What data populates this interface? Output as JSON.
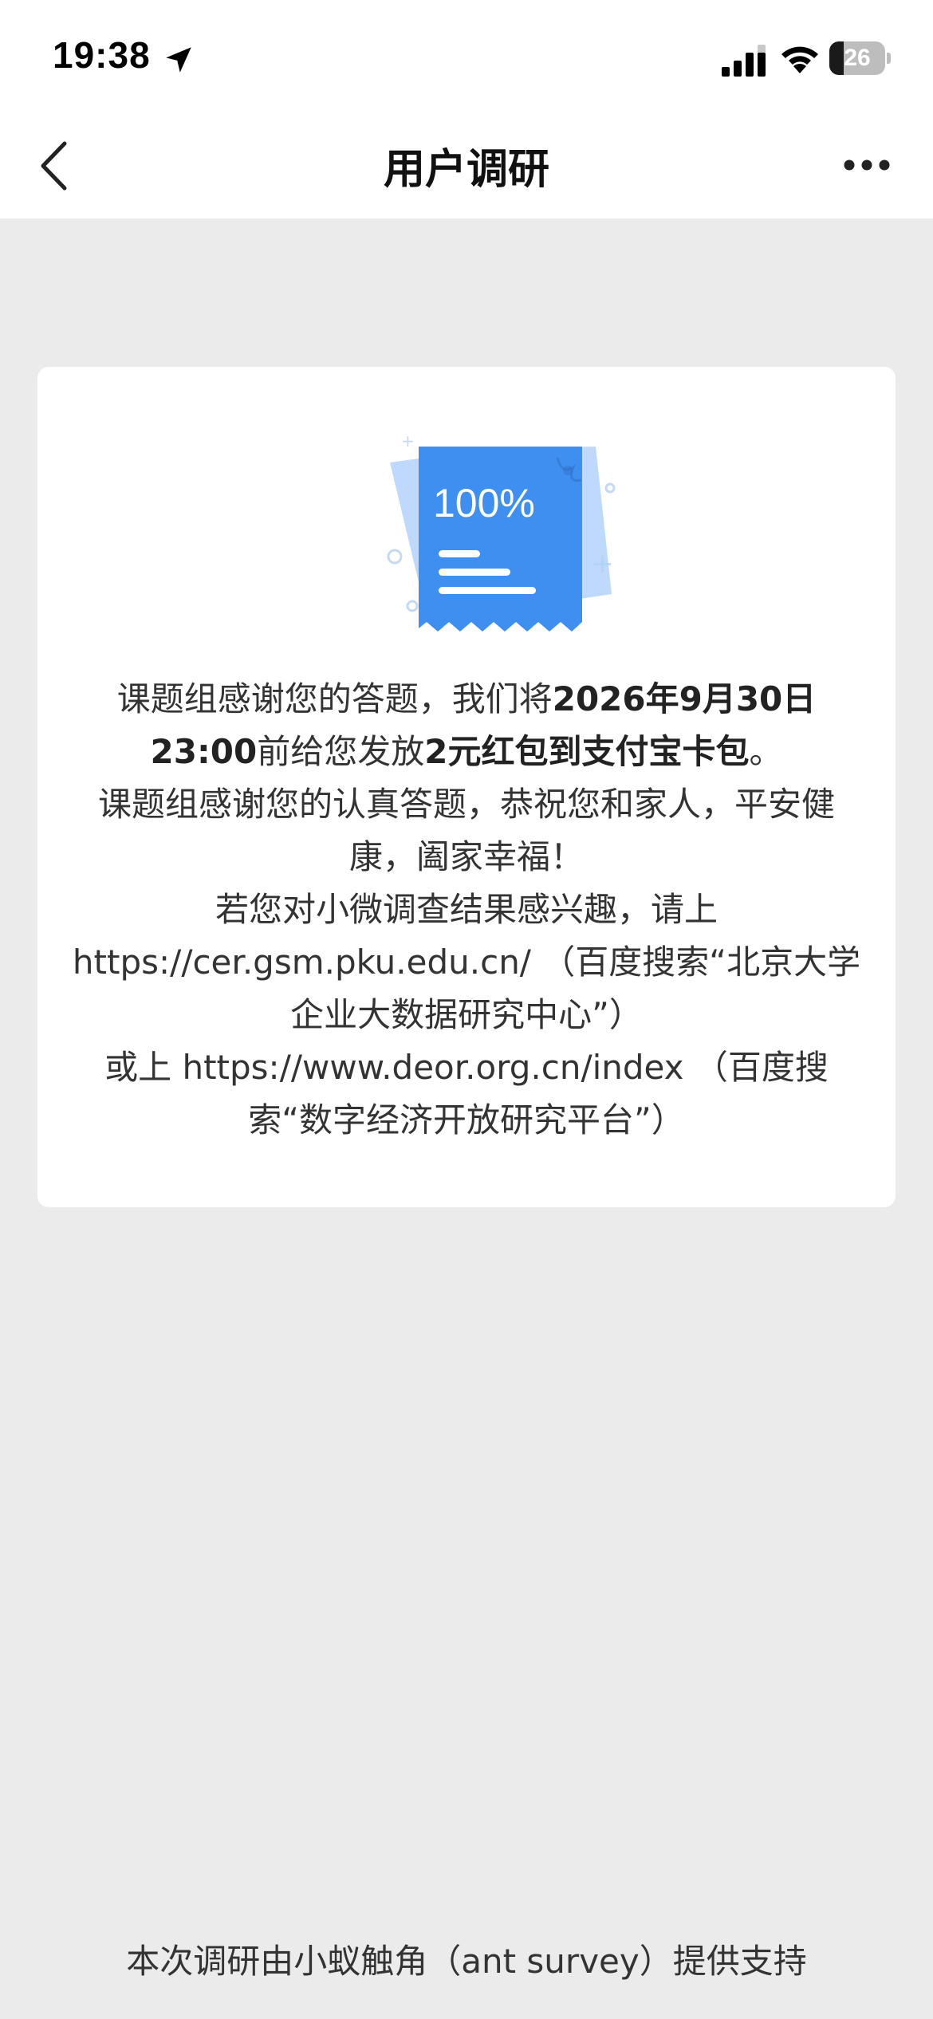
{
  "status_bar": {
    "time": "19:38",
    "battery_level": "26",
    "battery_fraction": 0.26,
    "icons": [
      "location-arrow-icon",
      "cellular-signal-icon",
      "wifi-icon",
      "battery-icon"
    ]
  },
  "nav": {
    "title": "用户调研",
    "back_icon": "chevron-left-icon",
    "more_icon": "more-dots-icon"
  },
  "card": {
    "illustration": {
      "percent_text": "100%",
      "icon": "survey-complete-receipt-icon",
      "colors": {
        "primary": "#3f8ff0",
        "secondary": "#aed0fa",
        "decoration": "#c5d9f3"
      }
    },
    "paragraph1": {
      "part1": "课题组感谢您的答题，我们将",
      "bold1": "2026年9月30日 23:00",
      "part2": "前给您发放",
      "bold2": "2元红包到支付宝卡包",
      "part3": "。"
    },
    "paragraph2": "课题组感谢您的认真答题，恭祝您和家人，平安健康，阖家幸福！",
    "paragraph3": "若您对小微调查结果感兴趣，请上 https://cer.gsm.pku.edu.cn/ （百度搜索“北京大学企业大数据研究中心”）",
    "paragraph4": "或上 https://www.deor.org.cn/index （百度搜索“数字经济开放研究平台”）"
  },
  "footer": {
    "text": "本次调研由小蚁触角（ant survey）提供支持"
  },
  "colors": {
    "page_background": "#ebebeb",
    "card_background": "#ffffff",
    "accent_blue": "#3f8ff0"
  }
}
